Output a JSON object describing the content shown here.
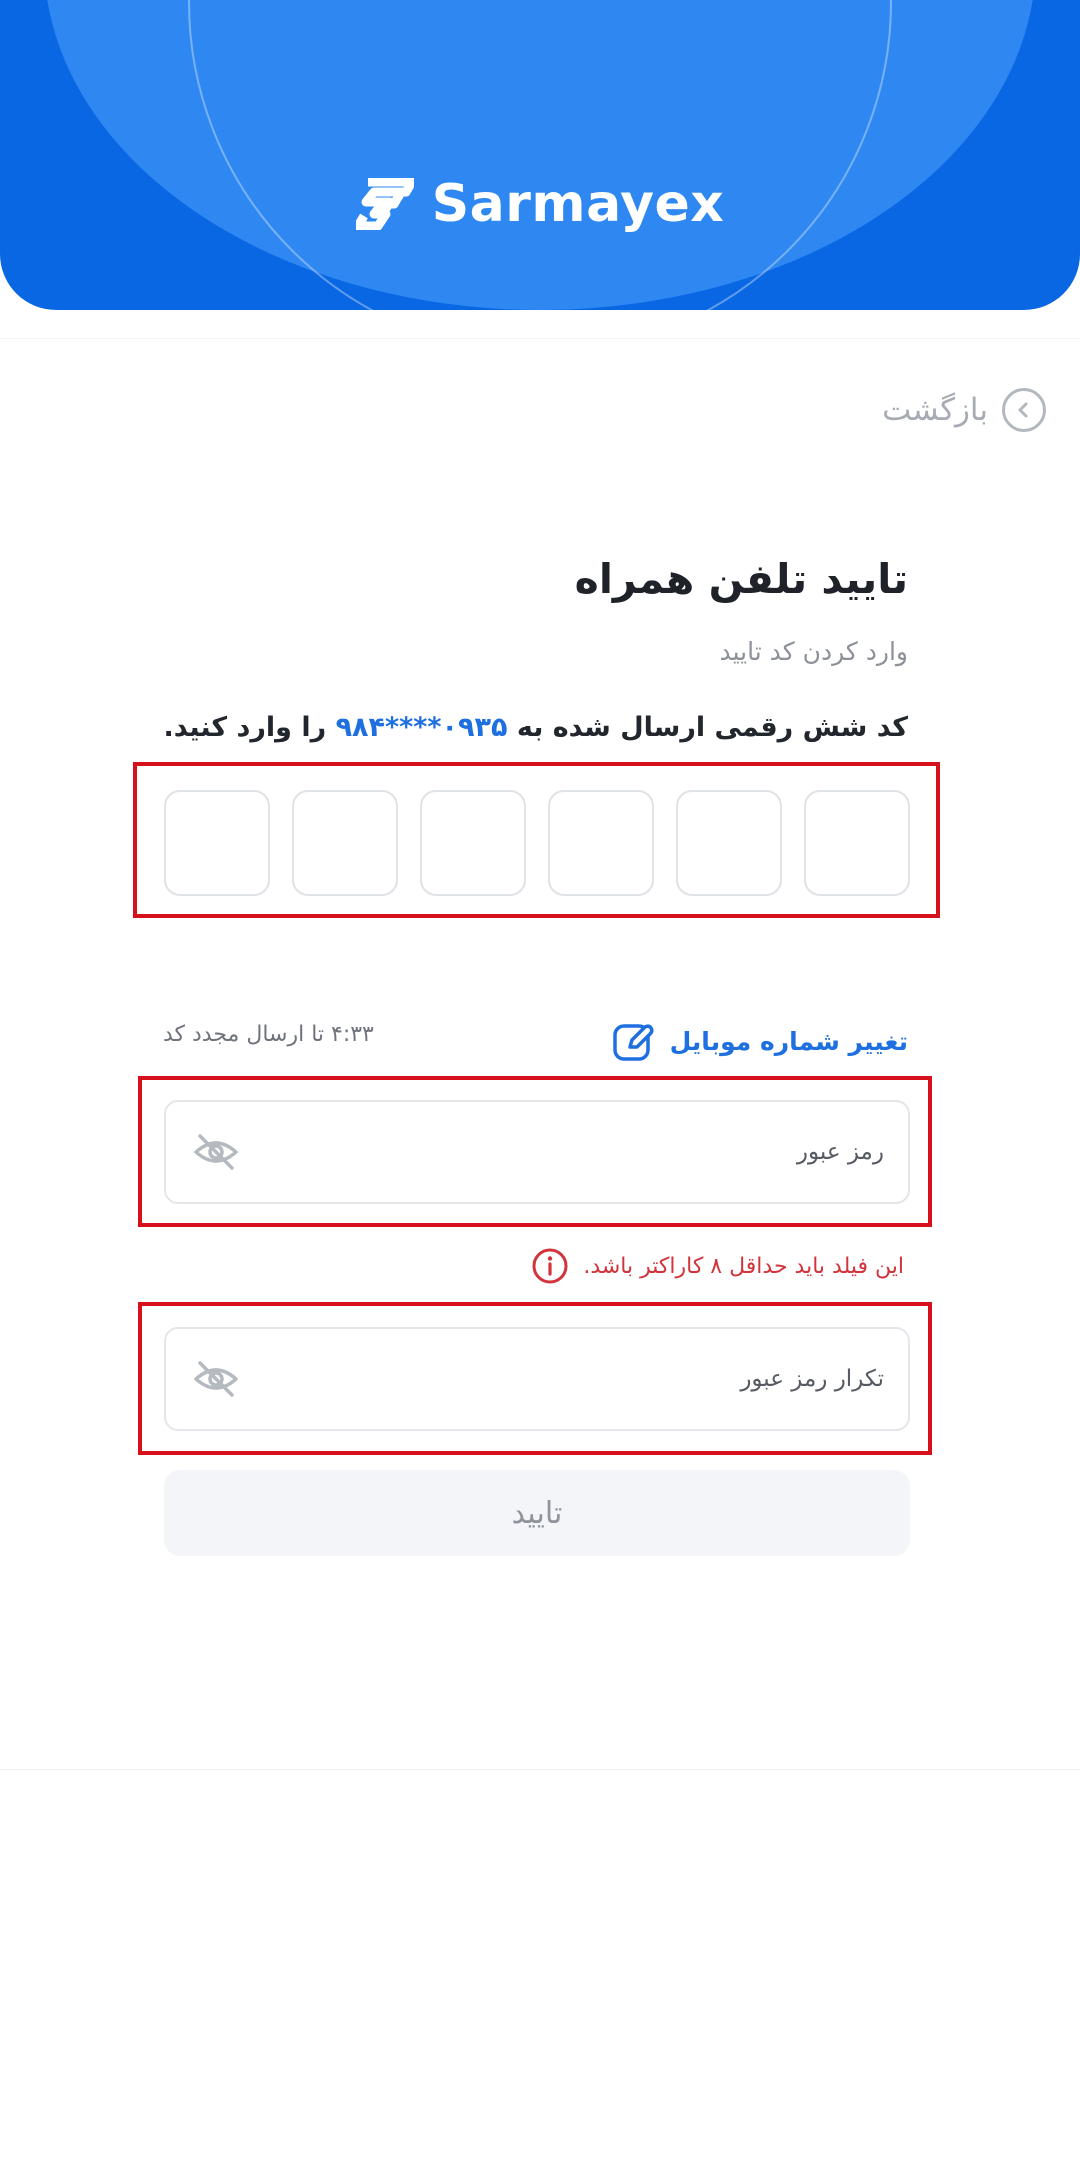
{
  "header": {
    "brand_name": "Sarmayex",
    "logo_icon": "sarmayex-logo-icon"
  },
  "back": {
    "label": "بازگشت",
    "icon": "chevron-left-circle-icon"
  },
  "verify": {
    "title": "تایید تلفن همراه",
    "subtitle": "وارد کردن کد تایید",
    "instruction_prefix": "کد شش رقمی ارسال شده به",
    "phone_masked": "۰۹۳۵****۹۸۴",
    "instruction_suffix": "را وارد کنید.",
    "otp_length": 6
  },
  "change_phone": {
    "label": "تغییر شماره موبایل",
    "icon": "edit-icon"
  },
  "resend": {
    "text": "۴:۳۳ تا ارسال مجدد کد"
  },
  "password": {
    "placeholder": "رمز عبور",
    "value": "",
    "toggle_icon": "eye-off-icon"
  },
  "password_error": {
    "text": "این فیلد باید حداقل ۸ کاراکتر باشد.",
    "icon": "info-icon"
  },
  "password_confirm": {
    "placeholder": "تکرار رمز عبور",
    "value": "",
    "toggle_icon": "eye-off-icon"
  },
  "submit": {
    "label": "تایید"
  },
  "colors": {
    "brand_blue": "#0a67e3",
    "link_blue": "#1e6fe0",
    "error_red": "#d1343b",
    "highlight_red": "#d7111b"
  }
}
